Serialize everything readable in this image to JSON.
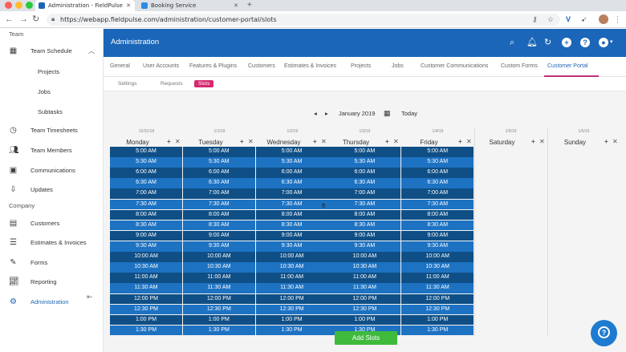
{
  "browser": {
    "tabs": [
      {
        "title": "Administration - FieldPulse",
        "active": true
      },
      {
        "title": "Booking Service",
        "active": false
      }
    ],
    "url": "https://webapp.fieldpulse.com/administration/customer-portal/slots",
    "new_tab": "+"
  },
  "sidebar": {
    "section_team": "Team",
    "section_company": "Company",
    "items": [
      {
        "label": "Team Schedule",
        "icon": "calendar-icon"
      },
      {
        "label": "Projects",
        "icon": ""
      },
      {
        "label": "Jobs",
        "icon": ""
      },
      {
        "label": "Subtasks",
        "icon": ""
      },
      {
        "label": "Team Timesheets",
        "icon": "clock-icon"
      },
      {
        "label": "Team Members",
        "icon": "people-icon"
      },
      {
        "label": "Communications",
        "icon": "id-card-icon"
      },
      {
        "label": "Updates",
        "icon": "download-icon"
      },
      {
        "label": "Customers",
        "icon": "contacts-icon"
      },
      {
        "label": "Estimates & Invoices",
        "icon": "invoice-icon"
      },
      {
        "label": "Forms",
        "icon": "form-icon"
      },
      {
        "label": "Reporting",
        "icon": "chart-icon"
      },
      {
        "label": "Administration",
        "icon": "gear-icon"
      }
    ]
  },
  "header": {
    "title": "Administration"
  },
  "tabs": [
    {
      "label": "General"
    },
    {
      "label": "User Accounts"
    },
    {
      "label": "Features & Plugins"
    },
    {
      "label": "Customers"
    },
    {
      "label": "Estimates & Invoices"
    },
    {
      "label": "Projects"
    },
    {
      "label": "Jobs"
    },
    {
      "label": "Customer Communications"
    },
    {
      "label": "Custom Forms"
    },
    {
      "label": "Customer Portal"
    }
  ],
  "subtabs": [
    {
      "label": "Settings"
    },
    {
      "label": "Requests"
    },
    {
      "label": "Slots"
    }
  ],
  "calendar": {
    "month_label": "January 2019",
    "today_label": "Today",
    "days": [
      {
        "date": "12/31/18",
        "name": "Monday"
      },
      {
        "date": "1/1/19",
        "name": "Tuesday"
      },
      {
        "date": "1/2/19",
        "name": "Wednesday"
      },
      {
        "date": "1/3/19",
        "name": "Thursday"
      },
      {
        "date": "1/4/19",
        "name": "Friday"
      },
      {
        "date": "1/5/19",
        "name": "Saturday"
      },
      {
        "date": "1/6/19",
        "name": "Sunday"
      }
    ],
    "times": [
      "5:00 AM",
      "5:30 AM",
      "6:00 AM",
      "6:30 AM",
      "7:00 AM",
      "7:30 AM",
      "8:00 AM",
      "8:30 AM",
      "9:00 AM",
      "9:30 AM",
      "10:00 AM",
      "10:30 AM",
      "11:00 AM",
      "11:30 AM",
      "12:00 PM",
      "12:30 PM",
      "1:00 PM",
      "1:30 PM"
    ],
    "add_slots_label": "Add Slots"
  },
  "colors": {
    "header_blue": "#1b66b8",
    "slot_dark": "#0f4f86",
    "slot_light": "#1d72c2",
    "accent_pink": "#d6286f",
    "add_green": "#3fba3d"
  }
}
